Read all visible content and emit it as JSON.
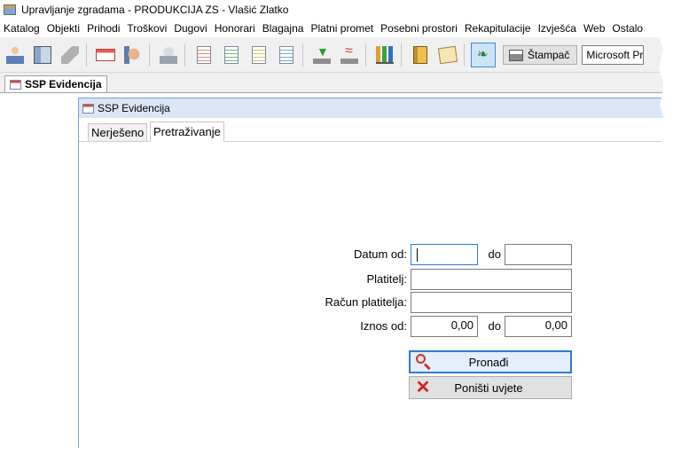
{
  "window": {
    "title": "Upravljanje zgradama - PRODUKCIJA ZS - Vlašić Zlatko"
  },
  "menu": [
    "Katalog",
    "Objekti",
    "Prihodi",
    "Troškovi",
    "Dugovi",
    "Honorari",
    "Blagajna",
    "Platni promet",
    "Posebni prostori",
    "Rekapitulacije",
    "Izvješća",
    "Web",
    "Ostalo"
  ],
  "toolbar": {
    "print_label": "Štampač",
    "printer_value": "Microsoft Print to PDF",
    "icons": [
      "user-icon",
      "building-icon",
      "tag-icon",
      "card-icon",
      "hand-icon",
      "cash-register-icon",
      "document-red-icon",
      "document-green-icon",
      "document-yellow-icon",
      "document-blue-icon",
      "download-icon",
      "wireless-icon",
      "bar-chart-icon",
      "binder-icon",
      "notebook-icon",
      "leaf-icon",
      "printer-icon"
    ]
  },
  "outer_tab": {
    "label": "SSP Evidencija"
  },
  "inner_window": {
    "title": "SSP Evidencija",
    "tabs": [
      "Nerješeno",
      "Pretraživanje"
    ]
  },
  "form": {
    "date_from_label": "Datum od:",
    "date_from_value": "",
    "to_label": "do",
    "date_to_value": "",
    "payer_label": "Platitelj:",
    "payer_value": "",
    "payer_account_label": "Račun platitelja:",
    "payer_account_value": "",
    "amount_from_label": "Iznos od:",
    "amount_from_value": "0,00",
    "amount_to_label": "do",
    "amount_to_value": "0,00"
  },
  "buttons": {
    "find": "Pronađi",
    "reset": "Poništi uvjete"
  },
  "colors": {
    "accent": "#2a7ad6",
    "inner_title_bg": "#dbe6f4",
    "reset_icon": "#d42020"
  }
}
